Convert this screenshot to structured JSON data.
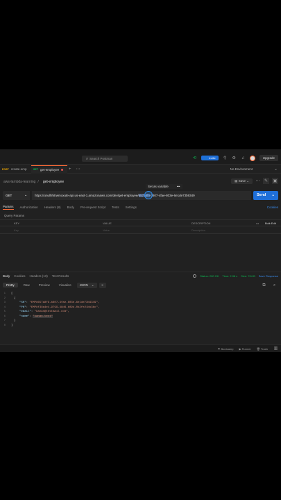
{
  "topbar": {
    "search_placeholder": "Search Postman",
    "invite_label": "Invite",
    "upgrade_label": "Upgrade"
  },
  "tabs": [
    {
      "method": "POST",
      "name": "create-emp"
    },
    {
      "method": "GET",
      "name": "get-employee"
    }
  ],
  "environment": {
    "label": "No Environment"
  },
  "breadcrumb": {
    "collection": "aws-lambda-learning",
    "separator": "/",
    "request": "get-employee"
  },
  "actions": {
    "save_label": "Save"
  },
  "tooltip": {
    "label": "Set as variable",
    "more": "•••"
  },
  "request": {
    "method": "GET",
    "url_prefix": "https://unulhhitrwmoxute-api.us-east-1.amazonaws.com/dev/get-employee/",
    "url_highlight": "657a8f9",
    "url_suffix": "-b807-4fae-803e-6e1de73b9349",
    "send_label": "Send"
  },
  "request_tabs": [
    "Params",
    "Authorization",
    "Headers (8)",
    "Body",
    "Pre-request Script",
    "Tests",
    "Settings"
  ],
  "cookies_label": "Cookies",
  "query_params": {
    "title": "Query Params",
    "col_key": "KEY",
    "col_value": "VALUE",
    "col_description": "DESCRIPTION",
    "bulk_edit": "Bulk Edit",
    "more": "•••",
    "ph_key": "Key",
    "ph_value": "Value",
    "ph_description": "Description"
  },
  "response_tabs": [
    "Body",
    "Cookies",
    "Headers (13)",
    "Test Results"
  ],
  "response_status": {
    "status": "Status: 200 OK",
    "time": "Time: 2.98 s",
    "size": "Size: 704 B",
    "save": "Save Response"
  },
  "view_modes": [
    "Pretty",
    "Raw",
    "Preview",
    "Visualize"
  ],
  "format": {
    "label": "JSON"
  },
  "code_lines": [
    {
      "n": "1",
      "text": "["
    },
    {
      "n": "2",
      "text": "{"
    },
    {
      "n": "3",
      "key": "\"SK\"",
      "value": "\"EMP#657a8f9-b807-4fae-803e-6e1de73b9349\","
    },
    {
      "n": "4",
      "key": "\"PK\"",
      "value": "\"EMP#f39a4e4-9799-48d6-b09d-0b2fe21bb3bc\","
    },
    {
      "n": "5",
      "key": "\"email\"",
      "value": "\"kanan@testmail.com\","
    },
    {
      "n": "6",
      "key": "\"name\"",
      "value": "\"kanan.test\""
    },
    {
      "n": "7",
      "text": "}"
    },
    {
      "n": "8",
      "text": "]"
    }
  ],
  "bottombar": {
    "bootcamp": "Bootcamp",
    "runner": "Runner",
    "trash": "Trash"
  }
}
